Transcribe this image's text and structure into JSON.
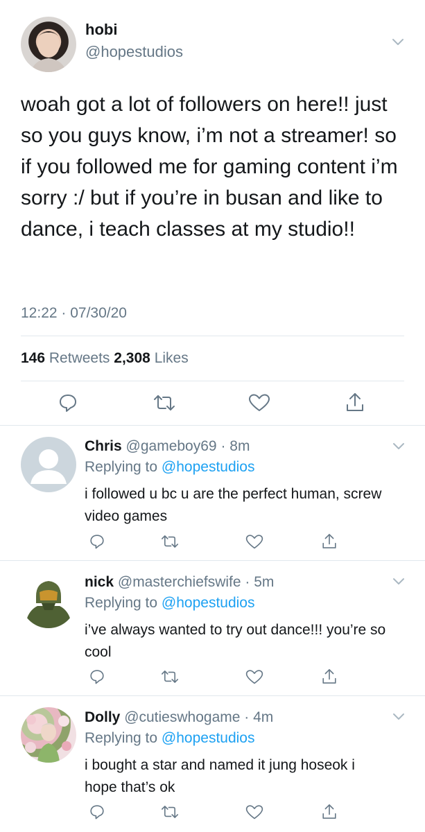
{
  "main_tweet": {
    "name": "hobi",
    "handle": "@hopestudios",
    "text": "woah got a lot of followers on here!! just so you guys know, i’m not a streamer! so if you followed me for gaming content i’m sorry :/ but if you’re in busan and like to dance, i teach classes at my studio!!",
    "timestamp": "12:22 · 07/30/20",
    "retweets_count": "146",
    "retweets_label": "Retweets",
    "likes_count": "2,308",
    "likes_label": "Likes"
  },
  "replies": [
    {
      "name": "Chris",
      "handle": "@gameboy69",
      "time": "· 8m",
      "replying_prefix": "Replying to",
      "replying_handle": "@hopestudios",
      "text": "i followed u bc u are the perfect human, screw video games"
    },
    {
      "name": "nick",
      "handle": "@masterchiefswife",
      "time": "· 5m",
      "replying_prefix": "Replying to",
      "replying_handle": "@hopestudios",
      "text": "i’ve always wanted to try out dance!!! you’re so cool"
    },
    {
      "name": "Dolly",
      "handle": "@cutieswhogame",
      "time": "· 4m",
      "replying_prefix": "Replying to",
      "replying_handle": "@hopestudios",
      "text": "i bought a star and named it jung hoseok i hope that’s ok"
    }
  ],
  "colors": {
    "text": "#14171a",
    "secondary": "#657786",
    "link": "#1da1f2",
    "divider": "#e1e8ed"
  },
  "icons": [
    "chevron-down-icon",
    "reply-icon",
    "retweet-icon",
    "like-icon",
    "share-icon"
  ]
}
